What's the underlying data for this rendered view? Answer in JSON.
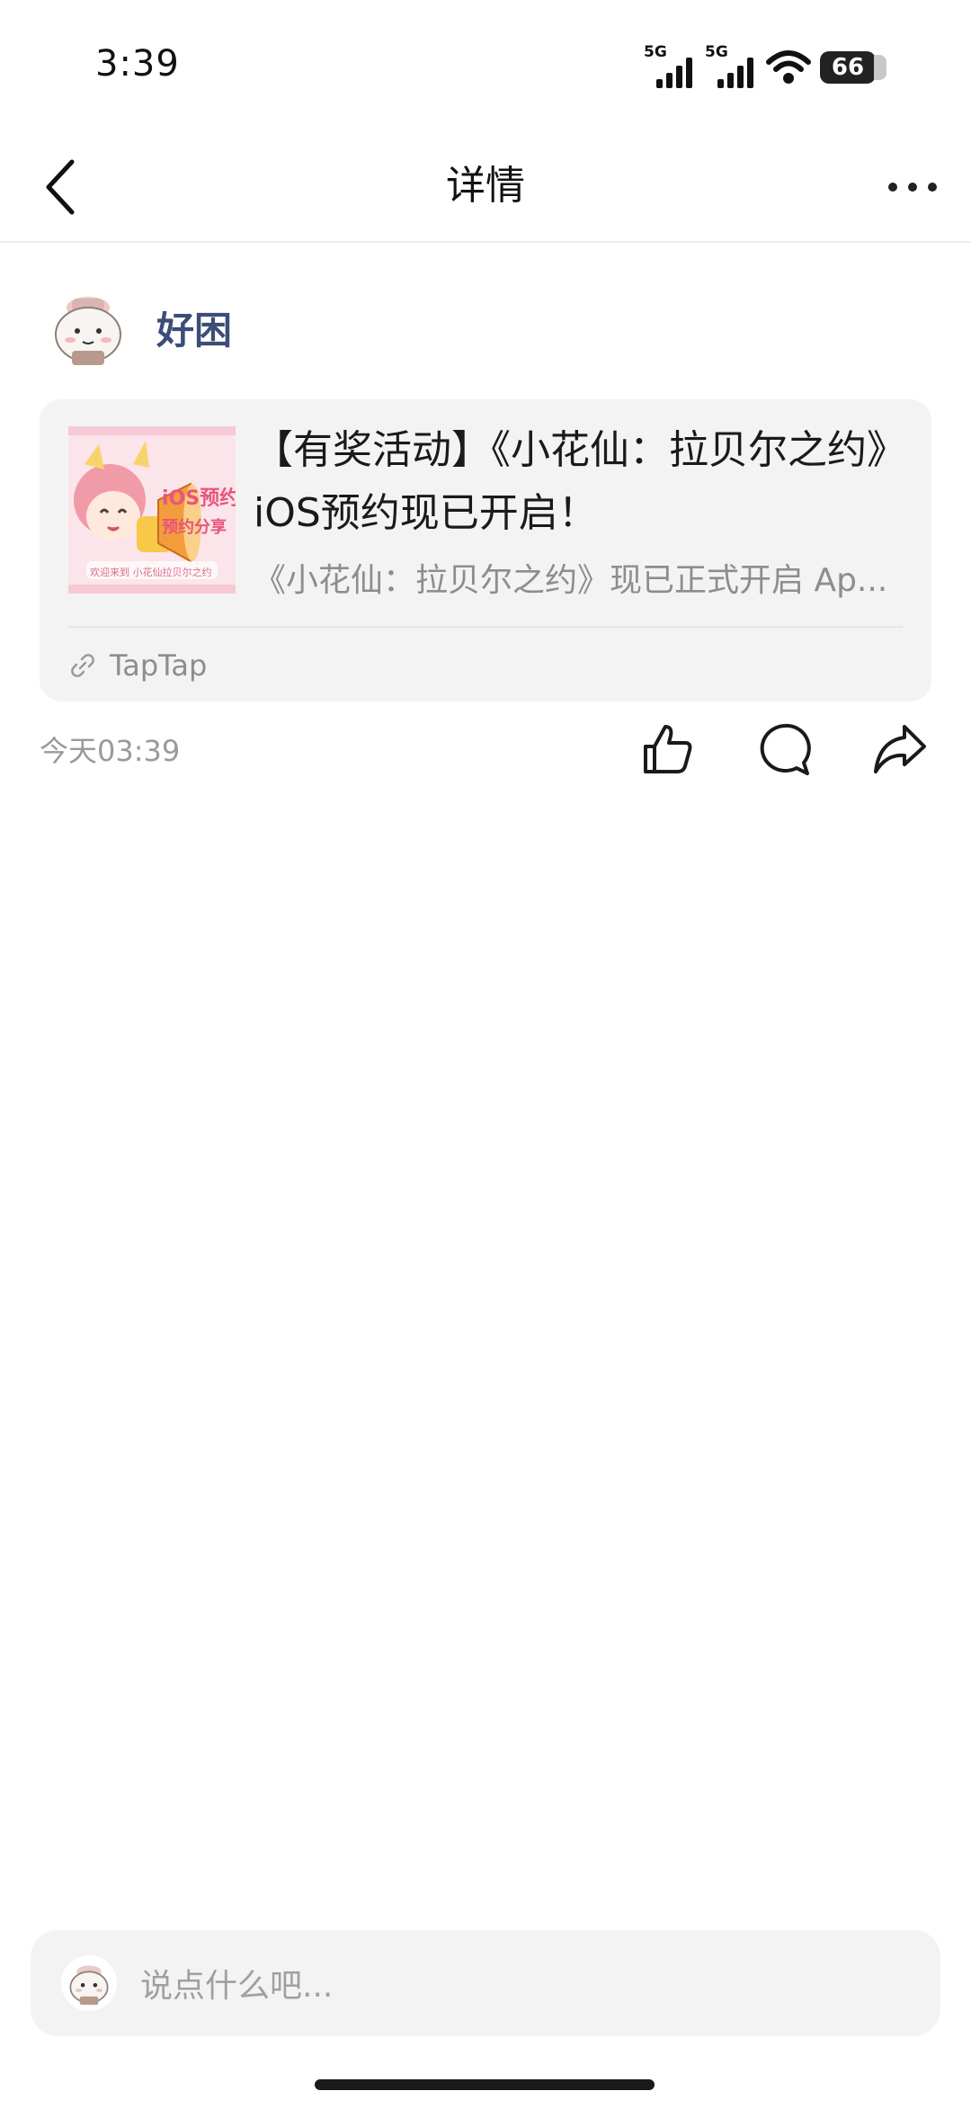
{
  "status_bar": {
    "time": "3:39",
    "signal_1": "5G",
    "signal_2": "5G",
    "battery": "66",
    "icons": [
      "signal-icon",
      "signal-icon",
      "wifi-icon",
      "battery-icon"
    ]
  },
  "nav": {
    "title": "详情",
    "icons": [
      "back-icon",
      "more-icon"
    ]
  },
  "author": {
    "name": "好困"
  },
  "link_card": {
    "title": "【有奖活动】《小花仙：拉贝尔之约》iOS预约现已开启！",
    "description": "《小花仙：拉贝尔之约》现已正式开启 Ap...",
    "source": "TapTap",
    "thumbnail": {
      "headline": "iOS预约",
      "subline": "预约分享",
      "footer": "欢迎来到 小花仙拉贝尔之约"
    }
  },
  "meta": {
    "time": "今天03:39",
    "icons": [
      "like-icon",
      "comment-icon",
      "share-icon"
    ]
  },
  "comment_bar": {
    "placeholder": "说点什么吧..."
  },
  "colors": {
    "accent_name": "#3c4d78",
    "card_bg": "#f3f3f4",
    "muted_text": "#8d8d8d"
  }
}
